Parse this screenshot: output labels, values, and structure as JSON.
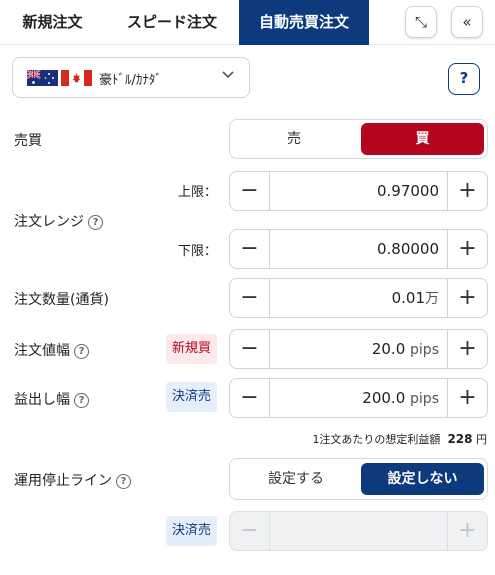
{
  "tabs": [
    {
      "label": "新規注文",
      "active": false
    },
    {
      "label": "スピード注文",
      "active": false
    },
    {
      "label": "自動売買注文",
      "active": true
    }
  ],
  "header_icons": [
    "collapse-icon",
    "double-chevron-left-icon"
  ],
  "header": {
    "collapse_glyph": "⤡",
    "back_glyph": "«"
  },
  "pair": {
    "label": "豪ﾄﾞﾙ/ｶﾅﾀﾞ",
    "flags": [
      "australia-flag-icon",
      "canada-flag-icon"
    ]
  },
  "help": {
    "glyph": "?"
  },
  "side": {
    "label": "売買",
    "options": [
      "売",
      "買"
    ],
    "selected": "買"
  },
  "range": {
    "label": "注文レンジ",
    "upper": {
      "label": "上限：",
      "value": "0.97000"
    },
    "lower": {
      "label": "下限：",
      "value": "0.80000"
    }
  },
  "quantity": {
    "label": "注文数量(通貨)",
    "value": "0.01",
    "unit": "万"
  },
  "order_width": {
    "label": "注文値幅",
    "badge": "新規買",
    "value": "20.0",
    "unit": "pips"
  },
  "profit_width": {
    "label": "益出し幅",
    "badge": "決済売",
    "value": "200.0",
    "unit": "pips"
  },
  "estimate": {
    "prefix": "1注文あたりの想定利益額",
    "amount": "228",
    "unit": "円"
  },
  "stop_line": {
    "label": "運用停止ライン",
    "options": [
      "設定する",
      "設定しない"
    ],
    "selected": "設定しない",
    "badge": "決済売"
  },
  "stepper_glyphs": {
    "minus": "−",
    "plus": "+"
  },
  "colors": {
    "navy": "#0d3a7d",
    "red": "#b4051e"
  }
}
